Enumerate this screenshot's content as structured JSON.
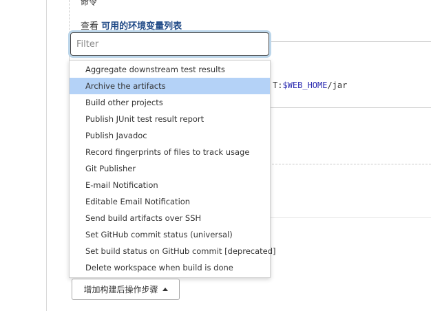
{
  "command": {
    "label": "命令"
  },
  "view_vars": {
    "prefix": "查看",
    "link": "可用的环境变量列表"
  },
  "code": {
    "tail_prefix": "T:",
    "var": "$WEB_HOME",
    "suffix": "/jar"
  },
  "filter": {
    "placeholder": "Filter",
    "value": ""
  },
  "menu": {
    "items": [
      {
        "label": "Aggregate downstream test results"
      },
      {
        "label": "Archive the artifacts"
      },
      {
        "label": "Build other projects"
      },
      {
        "label": "Publish JUnit test result report"
      },
      {
        "label": "Publish Javadoc"
      },
      {
        "label": "Record fingerprints of files to track usage"
      },
      {
        "label": "Git Publisher"
      },
      {
        "label": "E-mail Notification"
      },
      {
        "label": "Editable Email Notification"
      },
      {
        "label": "Send build artifacts over SSH"
      },
      {
        "label": "Set GitHub commit status (universal)"
      },
      {
        "label": "Set build status on GitHub commit [deprecated]"
      },
      {
        "label": "Delete workspace when build is done"
      }
    ],
    "highlighted_index": 1,
    "highlight_color": "#b4d2f7"
  },
  "add_post_build": {
    "label": "增加构建后操作步骤",
    "icon": "caret-up-icon"
  }
}
